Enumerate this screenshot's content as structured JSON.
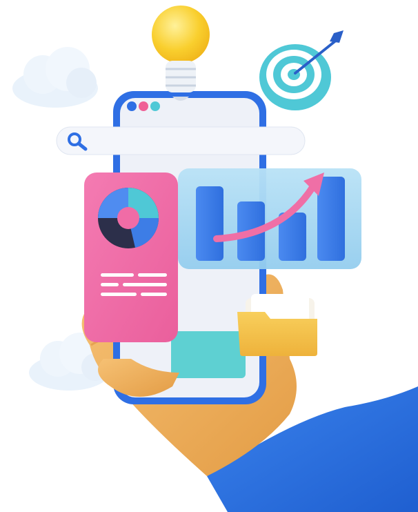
{
  "illustration": {
    "subject": "hand-holding-phone-analytics",
    "icons": [
      "light-bulb-icon",
      "target-icon",
      "search-icon",
      "donut-chart-icon",
      "bar-chart-icon",
      "folder-icon"
    ],
    "colors": {
      "phone_frame": "#2f6fe4",
      "phone_screen": "#eef1f8",
      "pink_card": "#f06ca6",
      "blue_panel": "#9fd3f0",
      "bars": "#3d7de6",
      "trend_arrow": "#ef6fa6",
      "bulb": "#f9cf2e",
      "target_ring": "#4fc8d6",
      "folder": "#f5c24a",
      "teal_block": "#5ed0d2",
      "hand": "#f0b060",
      "sleeve": "#2a70de",
      "cloud": "#e9f2fb"
    }
  }
}
